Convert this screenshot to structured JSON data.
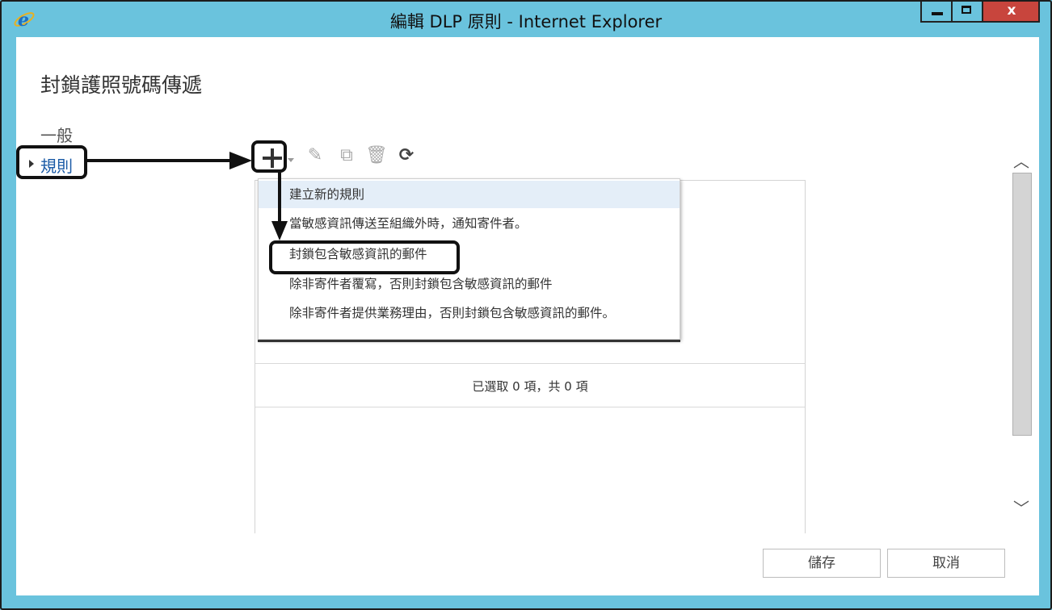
{
  "window": {
    "title": "編輯 DLP 原則 - Internet Explorer",
    "close_label": "x"
  },
  "page": {
    "title": "封鎖護照號碼傳遞"
  },
  "nav": {
    "items": [
      {
        "label": "一般"
      },
      {
        "label": "規則"
      }
    ]
  },
  "toolbar": {
    "icons": [
      "add-icon",
      "edit-icon",
      "copy-icon",
      "delete-icon",
      "refresh-icon"
    ]
  },
  "menu": {
    "items": [
      {
        "label": "建立新的規則"
      },
      {
        "label": "當敏感資訊傳送至組織外時，通知寄件者。"
      },
      {
        "label": "封鎖包含敏感資訊的郵件"
      },
      {
        "label": "除非寄件者覆寫，否則封鎖包含敏感資訊的郵件"
      },
      {
        "label": "除非寄件者提供業務理由，否則封鎖包含敏感資訊的郵件。"
      }
    ]
  },
  "grid": {
    "status": "已選取 0 項，共 0 項"
  },
  "footer": {
    "save_label": "儲存",
    "cancel_label": "取消"
  },
  "colors": {
    "window_frame": "#6ac3dd",
    "close_button": "#c8453d",
    "link": "#1a5aa6",
    "menu_highlight": "#e4eef8"
  }
}
